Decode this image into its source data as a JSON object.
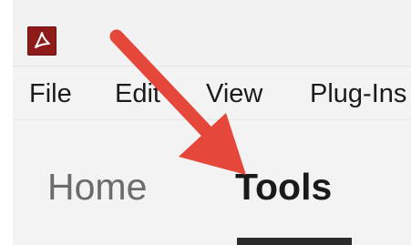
{
  "menubar": {
    "items": [
      "File",
      "Edit",
      "View",
      "Plug-Ins"
    ]
  },
  "tabs": {
    "home": "Home",
    "tools": "Tools",
    "active": "Tools"
  },
  "annotation": {
    "arrow_color": "#e5473a"
  },
  "icons": {
    "app": "acrobat-icon"
  },
  "colors": {
    "app_icon_bg": "#8e1a1a",
    "tab_inactive": "#6b6b6b",
    "tab_active": "#1a1a1a"
  }
}
